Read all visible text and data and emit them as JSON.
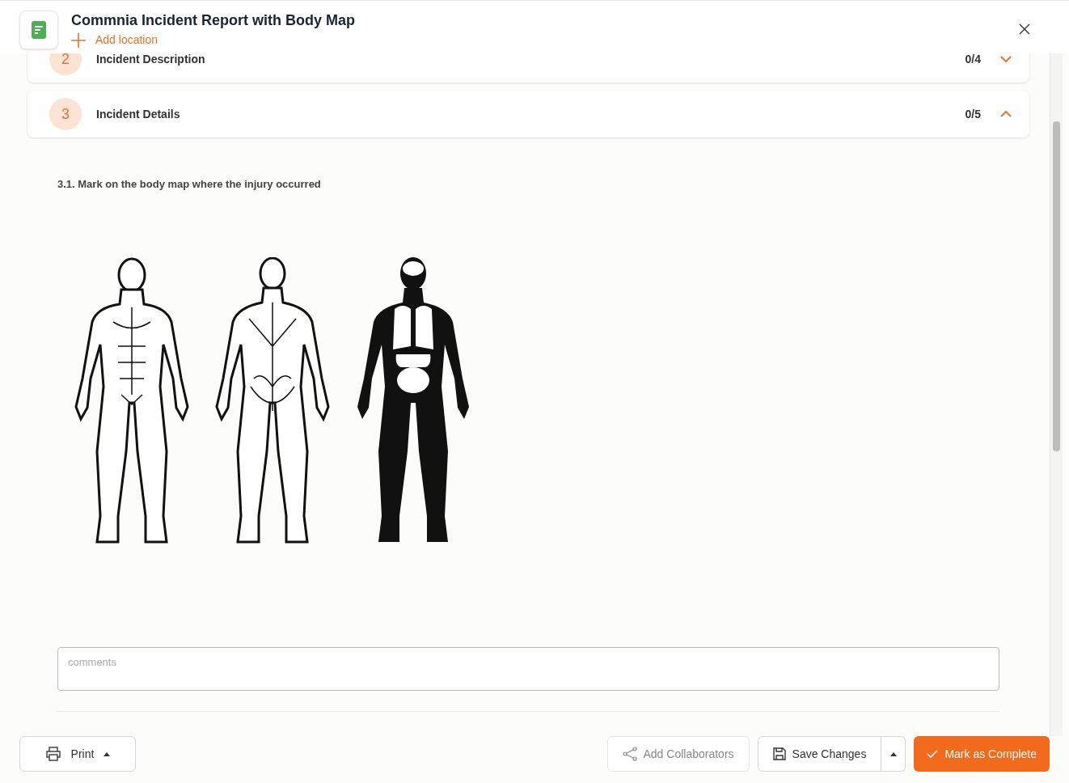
{
  "header": {
    "title": "Commnia Incident Report with Body Map",
    "add_location": "Add location"
  },
  "sections": [
    {
      "number": "2",
      "title": "Incident Description",
      "count": "0/4",
      "expanded": false
    },
    {
      "number": "3",
      "title": "Incident Details",
      "count": "0/5",
      "expanded": true
    }
  ],
  "question": {
    "label": "3.1. Mark on the body map where the injury occurred",
    "comments": {
      "placeholder": "comments"
    }
  },
  "footer": {
    "print": "Print",
    "buttons": [
      {
        "kind": "share",
        "label": "Add Collaborators",
        "disabled": true
      },
      {
        "kind": "save",
        "label": "Save Changes",
        "disabled": false
      },
      {
        "kind": "complete",
        "label": "Mark as Complete",
        "disabled": false
      }
    ]
  }
}
